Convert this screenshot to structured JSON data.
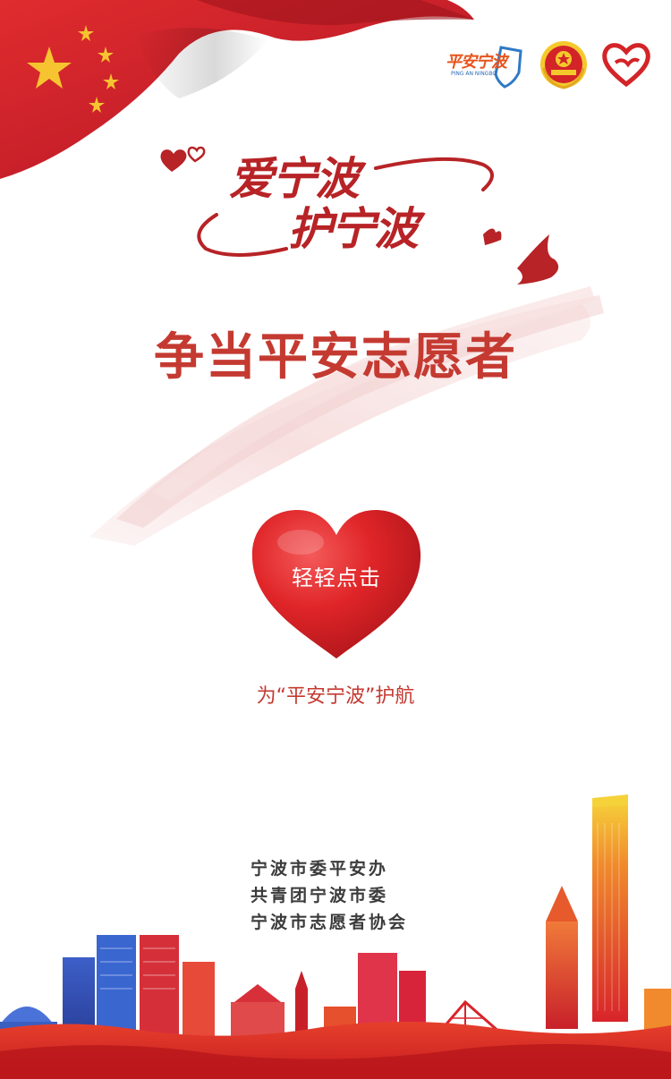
{
  "slogan": {
    "line1": "爱宁波",
    "line2": "护宁波"
  },
  "headline": "争当平安志愿者",
  "heart_button": {
    "label": "轻轻点击"
  },
  "caption": "为“平安宁波”护航",
  "logos": {
    "pingan_text": "平安宁波",
    "pingan_sub": "PING AN NINGBO",
    "icons": [
      "pingan-ningbo-logo",
      "communist-youth-league-emblem",
      "volunteer-heart-logo"
    ]
  },
  "organizers": [
    "宁波市委平安办",
    "共青团宁波市委",
    "宁波市志愿者协会"
  ],
  "colors": {
    "primary_red": "#c43a31",
    "dark_red": "#b72326",
    "flag_red": "#d4232a",
    "star_gold": "#f6c430",
    "text_dark": "#3b3b3b"
  }
}
